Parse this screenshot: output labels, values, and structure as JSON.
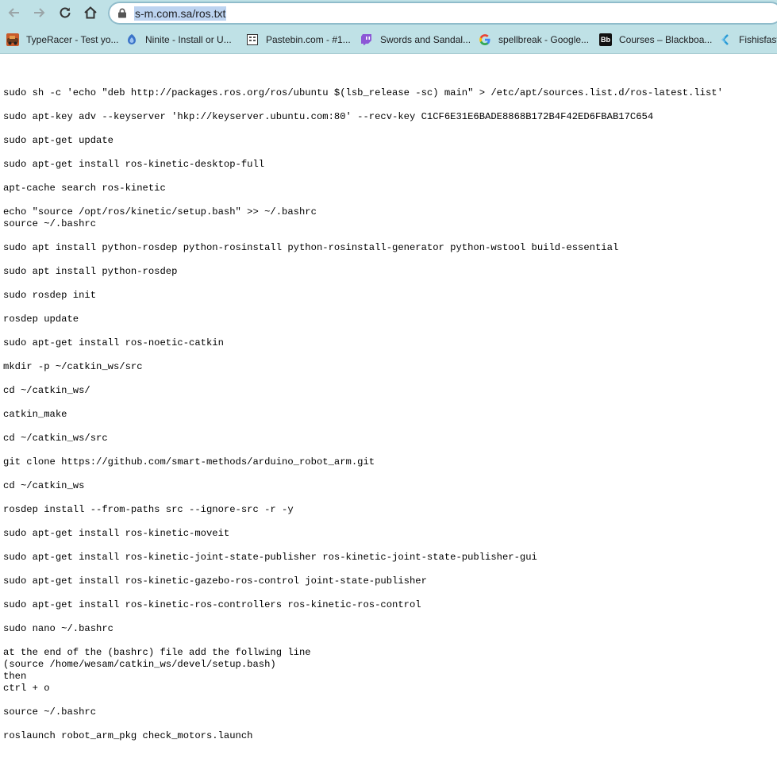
{
  "browser": {
    "url": "s-m.com.sa/ros.txt",
    "bookmarks": [
      {
        "label": "TypeRacer - Test yo...",
        "icon": "typeracer-icon"
      },
      {
        "label": "Ninite - Install or U...",
        "icon": "ninite-icon"
      },
      {
        "label": "Pastebin.com - #1...",
        "icon": "pastebin-icon"
      },
      {
        "label": "Swords and Sandal...",
        "icon": "twitch-icon"
      },
      {
        "label": "spellbreak - Google...",
        "icon": "google-icon"
      },
      {
        "label": "Courses – Blackboa...",
        "icon": "blackboard-icon"
      },
      {
        "label": "Fishisfast",
        "icon": "fishisfast-icon"
      }
    ]
  },
  "document": {
    "blocks": [
      [
        "sudo sh -c 'echo \"deb http://packages.ros.org/ros/ubuntu $(lsb_release -sc) main\" > /etc/apt/sources.list.d/ros-latest.list'"
      ],
      [
        "sudo apt-key adv --keyserver 'hkp://keyserver.ubuntu.com:80' --recv-key C1CF6E31E6BADE8868B172B4F42ED6FBAB17C654"
      ],
      [
        "sudo apt-get update"
      ],
      [
        "sudo apt-get install ros-kinetic-desktop-full"
      ],
      [
        "apt-cache search ros-kinetic"
      ],
      [
        "echo \"source /opt/ros/kinetic/setup.bash\" >> ~/.bashrc",
        "source ~/.bashrc"
      ],
      [
        "sudo apt install python-rosdep python-rosinstall python-rosinstall-generator python-wstool build-essential"
      ],
      [
        "sudo apt install python-rosdep"
      ],
      [
        "sudo rosdep init"
      ],
      [
        "rosdep update"
      ],
      [
        "sudo apt-get install ros-noetic-catkin"
      ],
      [
        "mkdir -p ~/catkin_ws/src"
      ],
      [
        "cd ~/catkin_ws/"
      ],
      [
        "catkin_make"
      ],
      [
        "cd ~/catkin_ws/src"
      ],
      [
        "git clone https://github.com/smart-methods/arduino_robot_arm.git"
      ],
      [
        "cd ~/catkin_ws"
      ],
      [
        "rosdep install --from-paths src --ignore-src -r -y"
      ],
      [
        "sudo apt-get install ros-kinetic-moveit"
      ],
      [
        "sudo apt-get install ros-kinetic-joint-state-publisher ros-kinetic-joint-state-publisher-gui"
      ],
      [
        "sudo apt-get install ros-kinetic-gazebo-ros-control joint-state-publisher"
      ],
      [
        "sudo apt-get install ros-kinetic-ros-controllers ros-kinetic-ros-control"
      ],
      [
        "sudo nano ~/.bashrc"
      ],
      [
        "at the end of the (bashrc) file add the follwing line",
        "(source /home/wesam/catkin_ws/devel/setup.bash)",
        "then",
        "ctrl + o"
      ],
      [
        "source ~/.bashrc"
      ],
      [
        "roslaunch robot_arm_pkg check_motors.launch"
      ]
    ]
  }
}
